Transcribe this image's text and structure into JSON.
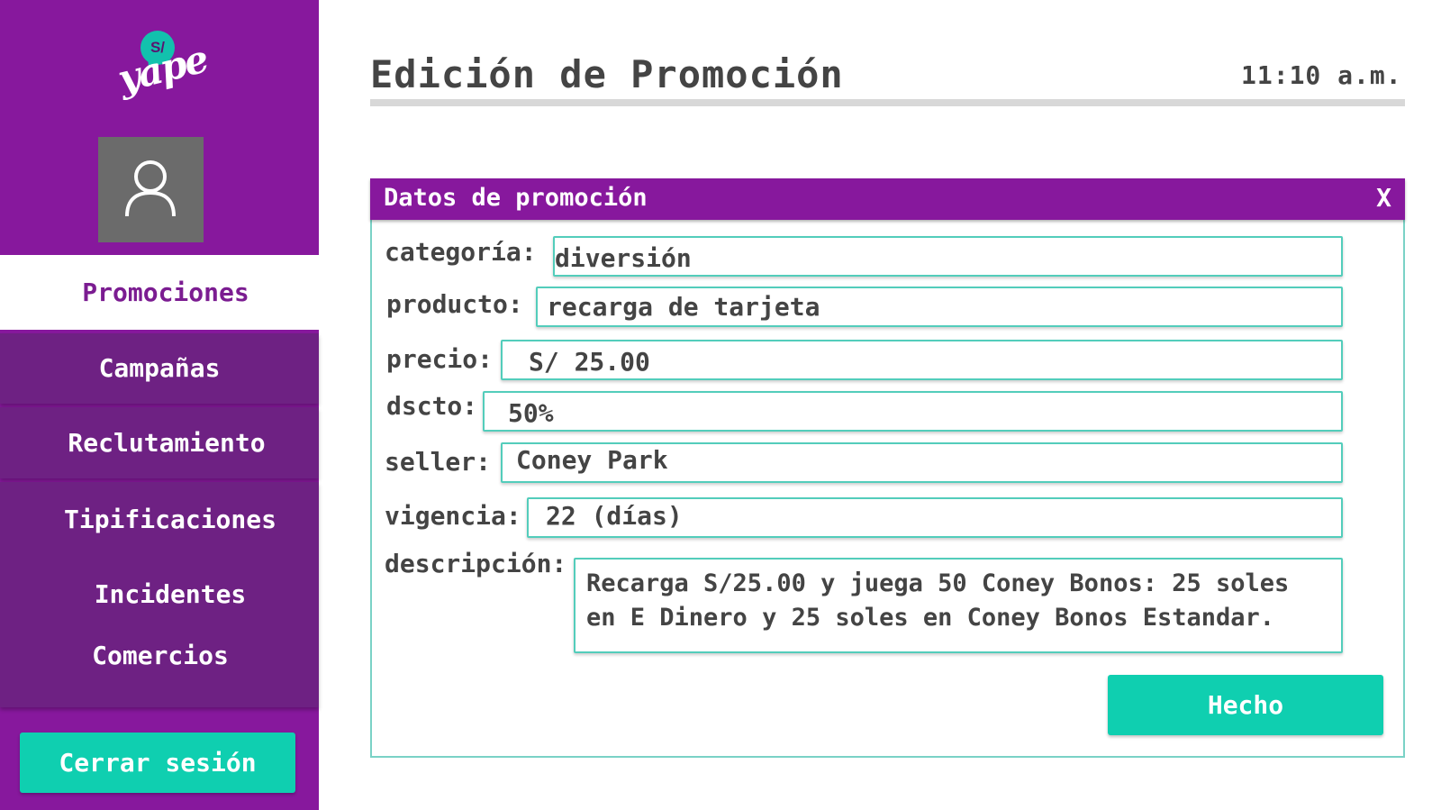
{
  "brand": {
    "logo_badge": "S/",
    "logo_text": "yape",
    "primary_color": "#87189d",
    "accent_color": "#0fcfb0"
  },
  "sidebar": {
    "items": [
      {
        "label": "Promociones",
        "active": true
      },
      {
        "label": "Campañas"
      },
      {
        "label": "Reclutamiento"
      },
      {
        "label": "Tipificaciones"
      },
      {
        "label": "Incidentes"
      },
      {
        "label": "Comercios"
      }
    ],
    "logout_label": "Cerrar sesión"
  },
  "header": {
    "title": "Edición de Promoción",
    "time": "11:10 a.m."
  },
  "dialog": {
    "title": "Datos de promoción",
    "close_label": "X",
    "fields": {
      "categoria": {
        "label": "categoría:",
        "value": "diversión"
      },
      "producto": {
        "label": "producto:",
        "value": "recarga de tarjeta"
      },
      "precio": {
        "label": "precio:",
        "value": "S/ 25.00"
      },
      "dscto": {
        "label": "dscto:",
        "value": "50%"
      },
      "seller": {
        "label": "seller:",
        "value": "Coney Park"
      },
      "vigencia": {
        "label": "vigencia:",
        "value": "22 (días)"
      },
      "descripcion": {
        "label": "descripción:",
        "value": "Recarga S/25.00 y juega 50 Coney Bonos: 25 soles en E Dinero y 25 soles en Coney Bonos Estandar."
      }
    },
    "done_label": "Hecho"
  }
}
